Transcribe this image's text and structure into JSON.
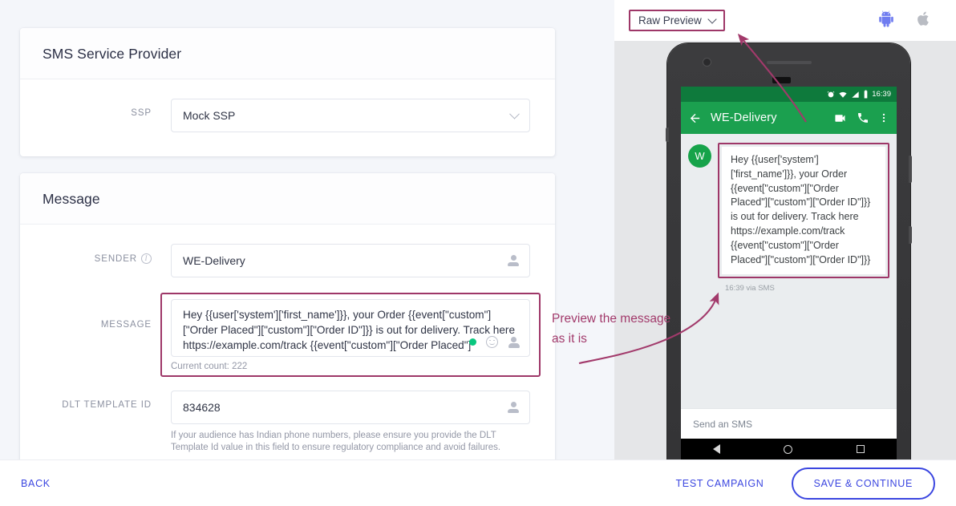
{
  "form": {
    "ssp_card": {
      "title": "SMS Service Provider",
      "ssp_label": "SSP",
      "ssp_value": "Mock SSP"
    },
    "message_card": {
      "title": "Message",
      "sender_label": "SENDER",
      "sender_value": "WE-Delivery",
      "message_label": "MESSAGE",
      "message_value": "Hey {{user['system']['first_name']}}, your Order {{event[\"custom\"][\"Order Placed\"][\"custom\"][\"Order ID\"]}} is out for delivery. Track here https://example.com/track {{event[\"custom\"][\"Order Placed\"][\"custom\"][\"Order ID\"]}}",
      "current_count": "Current count: 222",
      "dlt_label": "DLT TEMPLATE ID",
      "dlt_value": "834628",
      "dlt_helper": "If your audience has Indian phone numbers, please ensure you provide the DLT Template Id value in this field to ensure regulatory compliance and avoid failures."
    }
  },
  "preview": {
    "mode_label": "Raw Preview",
    "android_icon": "android-icon",
    "apple_icon": "apple-icon",
    "phone": {
      "status_time": "16:39",
      "contact_name": "WE-Delivery",
      "avatar_initial": "W",
      "bubble_text": "Hey {{user['system']['first_name']}}, your Order {{event[\"custom\"][\"Order Placed\"][\"custom\"][\"Order ID\"]}} is out for delivery. Track here https://example.com/track {{event[\"custom\"][\"Order Placed\"][\"custom\"][\"Order ID\"]}}",
      "message_meta": "16:39 via SMS",
      "composer_placeholder": "Send an SMS"
    }
  },
  "annotations": {
    "preview_note": "Preview the message as it is"
  },
  "footer": {
    "back": "BACK",
    "test_campaign": "TEST CAMPAIGN",
    "save_continue": "SAVE & CONTINUE"
  },
  "colors": {
    "accent_blue": "#3b46e0",
    "annotation": "#a23a6b",
    "android_green": "#1ba04f",
    "android_blue": "#6f7cf0"
  }
}
